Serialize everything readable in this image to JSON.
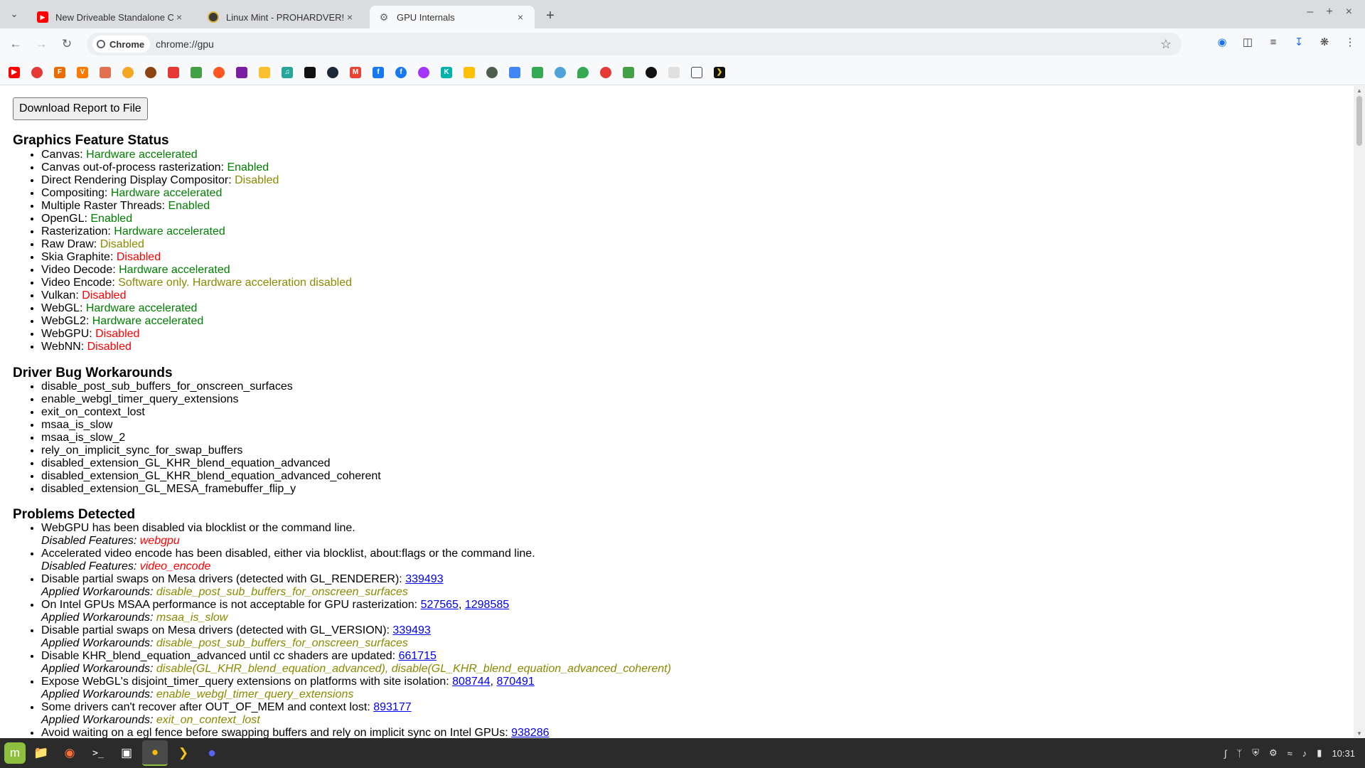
{
  "tabs": [
    {
      "title": "New Driveable Standalone C",
      "favicon": "youtube-icon",
      "color": "#ff0000",
      "active": false
    },
    {
      "title": "Linux Mint - PROHARDVER! ",
      "favicon": "prohardver-icon",
      "color": "#3a3a3a",
      "active": false
    },
    {
      "title": "GPU Internals",
      "favicon": "gear-icon",
      "color": "#5f6368",
      "active": true
    }
  ],
  "omnibox": {
    "chip": "Chrome",
    "url": "chrome://gpu"
  },
  "page": {
    "download_button": "Download Report to File",
    "feature_status": {
      "heading": "Graphics Feature Status",
      "items": [
        {
          "name": "Canvas: ",
          "value": "Hardware accelerated",
          "status": "green"
        },
        {
          "name": "Canvas out-of-process rasterization: ",
          "value": "Enabled",
          "status": "green"
        },
        {
          "name": "Direct Rendering Display Compositor: ",
          "value": "Disabled",
          "status": "olive"
        },
        {
          "name": "Compositing: ",
          "value": "Hardware accelerated",
          "status": "green"
        },
        {
          "name": "Multiple Raster Threads: ",
          "value": "Enabled",
          "status": "green"
        },
        {
          "name": "OpenGL: ",
          "value": "Enabled",
          "status": "green"
        },
        {
          "name": "Rasterization: ",
          "value": "Hardware accelerated",
          "status": "green"
        },
        {
          "name": "Raw Draw: ",
          "value": "Disabled",
          "status": "olive"
        },
        {
          "name": "Skia Graphite: ",
          "value": "Disabled",
          "status": "red"
        },
        {
          "name": "Video Decode: ",
          "value": "Hardware accelerated",
          "status": "green"
        },
        {
          "name": "Video Encode: ",
          "value": "Software only. Hardware acceleration disabled",
          "status": "olive"
        },
        {
          "name": "Vulkan: ",
          "value": "Disabled",
          "status": "red"
        },
        {
          "name": "WebGL: ",
          "value": "Hardware accelerated",
          "status": "green"
        },
        {
          "name": "WebGL2: ",
          "value": "Hardware accelerated",
          "status": "green"
        },
        {
          "name": "WebGPU: ",
          "value": "Disabled",
          "status": "red"
        },
        {
          "name": "WebNN: ",
          "value": "Disabled",
          "status": "red"
        }
      ]
    },
    "workarounds": {
      "heading": "Driver Bug Workarounds",
      "items": [
        "disable_post_sub_buffers_for_onscreen_surfaces",
        "enable_webgl_timer_query_extensions",
        "exit_on_context_lost",
        "msaa_is_slow",
        "msaa_is_slow_2",
        "rely_on_implicit_sync_for_swap_buffers",
        "disabled_extension_GL_KHR_blend_equation_advanced",
        "disabled_extension_GL_KHR_blend_equation_advanced_coherent",
        "disabled_extension_GL_MESA_framebuffer_flip_y"
      ]
    },
    "problems": {
      "heading": "Problems Detected",
      "items": [
        {
          "text": "WebGPU has been disabled via blocklist or the command line.",
          "links": [],
          "sub_label": "Disabled Features: ",
          "sub_value": "webgpu",
          "sub_kind": "red"
        },
        {
          "text": "Accelerated video encode has been disabled, either via blocklist, about:flags or the command line.",
          "links": [],
          "sub_label": "Disabled Features: ",
          "sub_value": "video_encode",
          "sub_kind": "red"
        },
        {
          "text": "Disable partial swaps on Mesa drivers (detected with GL_RENDERER): ",
          "links": [
            "339493"
          ],
          "sub_label": "Applied Workarounds: ",
          "sub_value": "disable_post_sub_buffers_for_onscreen_surfaces",
          "sub_kind": "olive"
        },
        {
          "text": "On Intel GPUs MSAA performance is not acceptable for GPU rasterization: ",
          "links": [
            "527565",
            "1298585"
          ],
          "sub_label": "Applied Workarounds: ",
          "sub_value": "msaa_is_slow",
          "sub_kind": "olive"
        },
        {
          "text": "Disable partial swaps on Mesa drivers (detected with GL_VERSION): ",
          "links": [
            "339493"
          ],
          "sub_label": "Applied Workarounds: ",
          "sub_value": "disable_post_sub_buffers_for_onscreen_surfaces",
          "sub_kind": "olive"
        },
        {
          "text": "Disable KHR_blend_equation_advanced until cc shaders are updated: ",
          "links": [
            "661715"
          ],
          "sub_label": "Applied Workarounds: ",
          "sub_value": "disable(GL_KHR_blend_equation_advanced), disable(GL_KHR_blend_equation_advanced_coherent)",
          "sub_kind": "olive"
        },
        {
          "text": "Expose WebGL's disjoint_timer_query extensions on platforms with site isolation: ",
          "links": [
            "808744",
            "870491"
          ],
          "sub_label": "Applied Workarounds: ",
          "sub_value": "enable_webgl_timer_query_extensions",
          "sub_kind": "olive"
        },
        {
          "text": "Some drivers can't recover after OUT_OF_MEM and context lost: ",
          "links": [
            "893177"
          ],
          "sub_label": "Applied Workarounds: ",
          "sub_value": "exit_on_context_lost",
          "sub_kind": "olive"
        },
        {
          "text": "Avoid waiting on a egl fence before swapping buffers and rely on implicit sync on Intel GPUs: ",
          "links": [
            "938286"
          ],
          "sub_label": "",
          "sub_value": "",
          "sub_kind": "olive"
        }
      ]
    }
  },
  "taskbar": {
    "apps": [
      "mint-menu-icon",
      "files-icon",
      "firefox-icon",
      "terminal-icon",
      "window-list-icon",
      "chrome-icon",
      "plex-icon",
      "discord-icon"
    ],
    "clock": "10:31"
  },
  "colors": {
    "green": "#008000",
    "olive": "#8a8a00",
    "red": "#ff0000",
    "link": "#0000ee"
  }
}
